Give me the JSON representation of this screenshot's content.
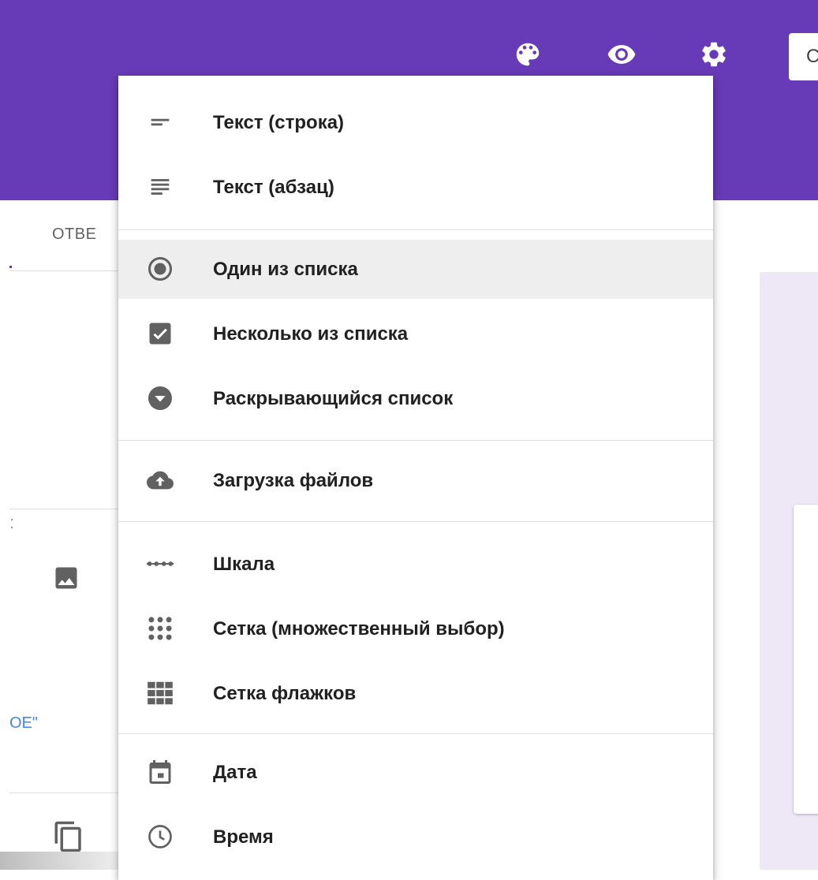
{
  "header": {
    "background": "#673ab7",
    "icons": [
      "palette-icon",
      "preview-eye-icon",
      "settings-gear-icon"
    ],
    "button_partial_label": "С"
  },
  "background_form": {
    "tab_partial_label": "ОТВЕ",
    "colon": ":",
    "quote_partial": "ОЕ\"",
    "icons": [
      "image-icon",
      "copy-icon"
    ]
  },
  "menu": {
    "selected_index": 2,
    "items": [
      {
        "label": "Текст (строка)",
        "icon": "short-text-icon"
      },
      {
        "label": "Текст (абзац)",
        "icon": "paragraph-icon"
      },
      {
        "label": "Один из списка",
        "icon": "radio-button-icon"
      },
      {
        "label": "Несколько из списка",
        "icon": "checkbox-icon"
      },
      {
        "label": "Раскрывающийся список",
        "icon": "dropdown-icon"
      },
      {
        "label": "Загрузка файлов",
        "icon": "cloud-upload-icon"
      },
      {
        "label": "Шкала",
        "icon": "linear-scale-icon"
      },
      {
        "label": "Сетка (множественный выбор)",
        "icon": "multiple-choice-grid-icon"
      },
      {
        "label": "Сетка флажков",
        "icon": "checkbox-grid-icon"
      },
      {
        "label": "Дата",
        "icon": "calendar-icon"
      },
      {
        "label": "Время",
        "icon": "clock-icon"
      }
    ]
  }
}
